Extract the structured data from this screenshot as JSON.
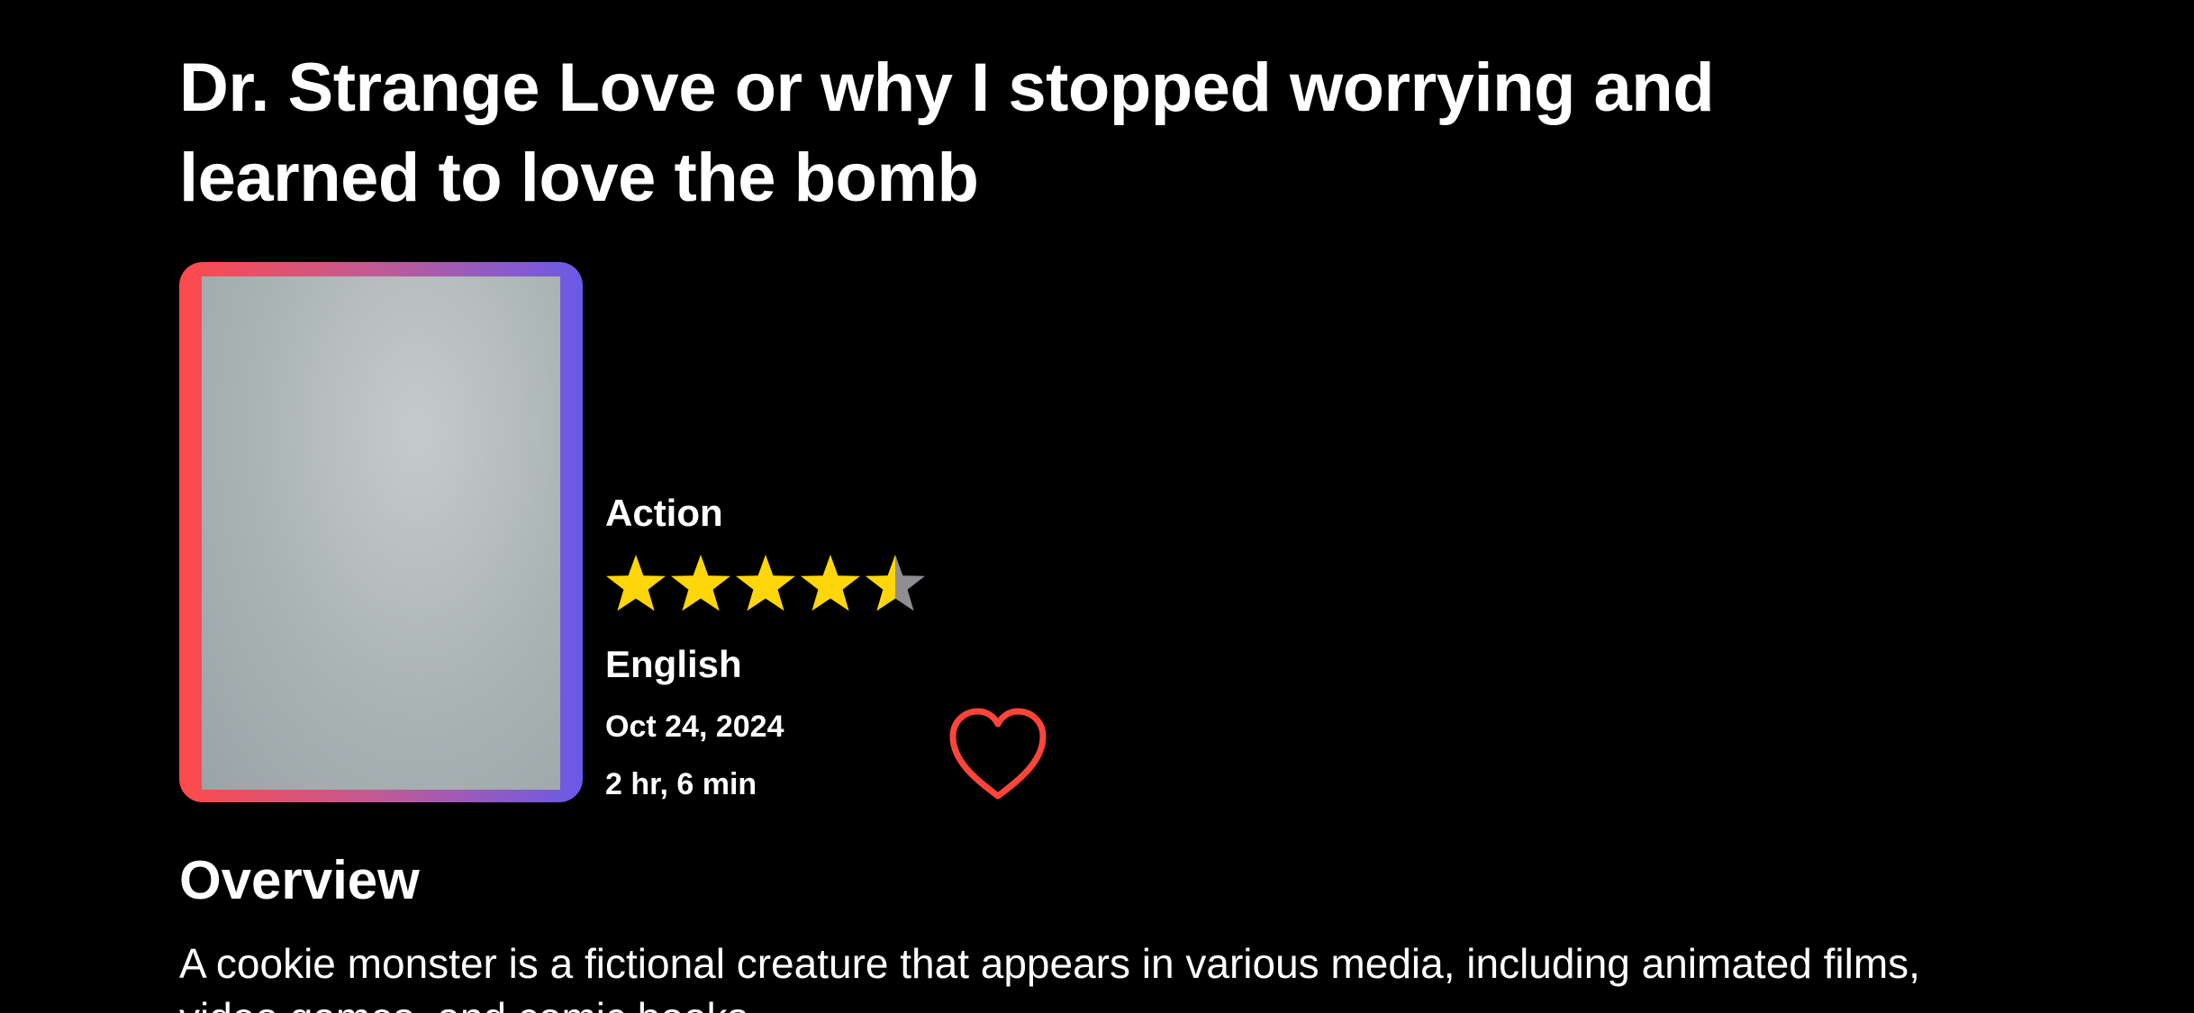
{
  "movie": {
    "title": "Dr. Strange Love or why I stopped worrying and learned to love the bomb",
    "genre": "Action",
    "language": "English",
    "release_date": "Oct 24, 2024",
    "runtime": "2 hr, 6 min",
    "rating": {
      "value": 4.5,
      "max": 5,
      "filled_color": "#FFD60A",
      "empty_color": "#8E8E93"
    },
    "poster": {
      "icon": "poster-image",
      "border_gradient": [
        "#FF4A4A",
        "#6A5AE8"
      ]
    }
  },
  "favorite": {
    "icon": "heart-outline-icon",
    "color": "#FF453A",
    "selected": false
  },
  "overview": {
    "heading": "Overview",
    "text": "A cookie monster is a fictional creature that appears in various media, including animated films, video games, and comic books."
  }
}
